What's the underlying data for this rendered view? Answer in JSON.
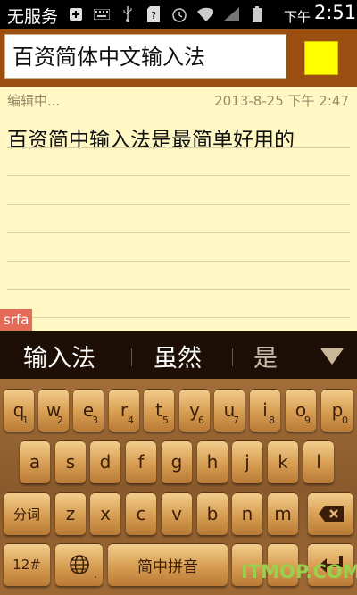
{
  "status_bar": {
    "carrier": "无服务",
    "icons": [
      "plus-box-icon",
      "keyboard-icon",
      "usb-icon",
      "sim-unknown-icon",
      "alarm-icon",
      "wifi-icon",
      "signal-icon",
      "battery-icon"
    ],
    "time_prefix": "下午",
    "time": "2:51"
  },
  "title_bar": {
    "title_value": "百资简体中文输入法",
    "color_swatch": "#ffff00"
  },
  "note": {
    "status": "编辑中...",
    "timestamp": "2013-8-25 下午 2:47",
    "body": "百资简中输入法是最简单好用的"
  },
  "ime": {
    "composing_text": "srfa",
    "candidates": [
      "输入法",
      "虽然",
      "是"
    ]
  },
  "keyboard": {
    "row1": [
      {
        "label": "q",
        "sub": "1"
      },
      {
        "label": "w",
        "sub": "2"
      },
      {
        "label": "e",
        "sub": "3"
      },
      {
        "label": "r",
        "sub": "4"
      },
      {
        "label": "t",
        "sub": "5"
      },
      {
        "label": "y",
        "sub": "6"
      },
      {
        "label": "u",
        "sub": "7"
      },
      {
        "label": "i",
        "sub": "8"
      },
      {
        "label": "o",
        "sub": "9"
      },
      {
        "label": "p",
        "sub": "0"
      }
    ],
    "row2": [
      "a",
      "s",
      "d",
      "f",
      "g",
      "h",
      "j",
      "k",
      "l"
    ],
    "row3": [
      "z",
      "x",
      "c",
      "v",
      "b",
      "n",
      "m"
    ],
    "fenci_label": "分词",
    "mode_label": "12#",
    "space_label": "简中拼音",
    "dot_label": "."
  },
  "watermark": "ITMOP.COM",
  "colors": {
    "title_bar": "#9a4e10",
    "note_background": "#fff8c4",
    "candidate_bar": "#1e0f06",
    "composing_badge": "#e46b57",
    "key_face": "#d79d52"
  }
}
